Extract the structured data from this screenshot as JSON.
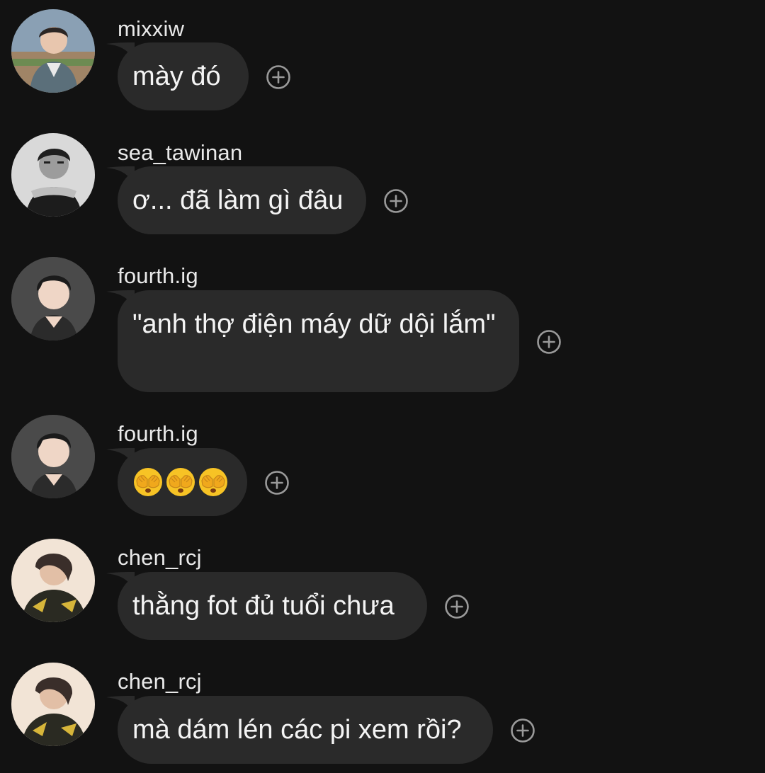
{
  "messages": [
    {
      "username": "mixxiw",
      "text": "mày đó",
      "avatar": "avatar-photo-mixxiw"
    },
    {
      "username": "sea_tawinan",
      "text": "ơ... đã làm gì đâu",
      "avatar": "avatar-photo-sea-tawinan"
    },
    {
      "username": "fourth.ig",
      "text": "\"anh thợ điện máy dữ dội lắm\"",
      "avatar": "avatar-photo-fourth-ig"
    },
    {
      "username": "fourth.ig",
      "text": "",
      "emoji": [
        "face-with-hands-over-eyes",
        "face-with-hands-over-eyes",
        "face-with-hands-over-eyes"
      ],
      "avatar": "avatar-photo-fourth-ig"
    },
    {
      "username": "chen_rcj",
      "text": "thằng fot đủ tuổi chưa",
      "avatar": "avatar-photo-chen-rcj"
    },
    {
      "username": "chen_rcj",
      "text": "mà dám lén các pi xem rồi?",
      "avatar": "avatar-photo-chen-rcj"
    }
  ],
  "colors": {
    "background": "#121212",
    "bubble": "#2a2a2a",
    "text": "#f4f4f4",
    "icon": "#9a9a9a"
  },
  "icons": {
    "reaction": "add-reaction-icon"
  }
}
